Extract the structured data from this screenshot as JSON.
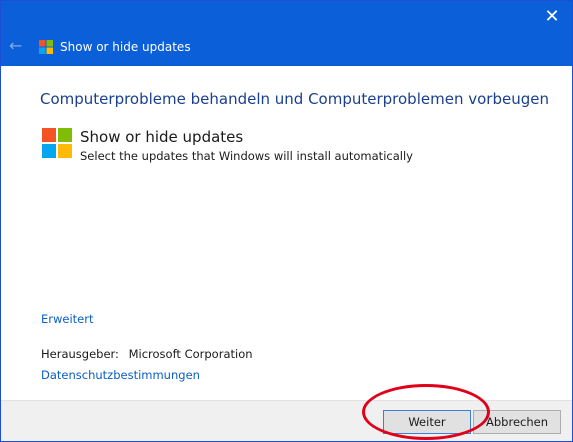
{
  "window": {
    "title": "Show or hide updates",
    "back_icon": "arrow-left-icon",
    "close_icon": "close-icon",
    "colors": {
      "titlebar": "#0b5fd8",
      "heading": "#1a3f8f",
      "link": "#0a5ec4",
      "annotation": "#e0001a"
    }
  },
  "main": {
    "heading": "Computerprobleme behandeln und Computerproblemen vorbeugen",
    "app_title": "Show or hide updates",
    "app_description": "Select the updates that Windows will install automatically",
    "advanced_link": "Erweitert",
    "publisher_label": "Herausgeber:",
    "publisher_value": "Microsoft Corporation",
    "privacy_link": "Datenschutzbestimmungen"
  },
  "footer": {
    "next_label": "Weiter",
    "cancel_label": "Abbrechen"
  }
}
